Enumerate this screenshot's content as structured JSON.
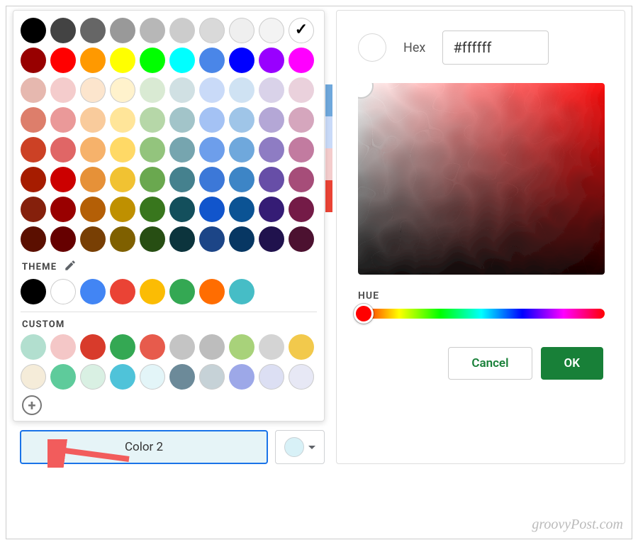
{
  "palette_rows": [
    [
      "#000000",
      "#434343",
      "#666666",
      "#999999",
      "#b7b7b7",
      "#cccccc",
      "#d9d9d9",
      "#efefef",
      "#f3f3f3",
      "#ffffff"
    ],
    [
      "#980000",
      "#ff0000",
      "#ff9900",
      "#ffff00",
      "#00ff00",
      "#00ffff",
      "#4a86e8",
      "#0000ff",
      "#9900ff",
      "#ff00ff"
    ],
    [
      "#e6b8af",
      "#f4cccc",
      "#fce5cd",
      "#fff2cc",
      "#d9ead3",
      "#d0e0e3",
      "#c9daf8",
      "#cfe2f3",
      "#d9d2e9",
      "#ead1dc"
    ],
    [
      "#dd7e6b",
      "#ea9999",
      "#f9cb9c",
      "#ffe599",
      "#b6d7a8",
      "#a2c4c9",
      "#a4c2f4",
      "#9fc5e8",
      "#b4a7d6",
      "#d5a6bd"
    ],
    [
      "#cc4125",
      "#e06666",
      "#f6b26b",
      "#ffd966",
      "#93c47d",
      "#76a5af",
      "#6d9eeb",
      "#6fa8dc",
      "#8e7cc3",
      "#c27ba0"
    ],
    [
      "#a61c00",
      "#cc0000",
      "#e69138",
      "#f1c232",
      "#6aa84f",
      "#45818e",
      "#3c78d8",
      "#3d85c6",
      "#674ea7",
      "#a64d79"
    ],
    [
      "#85200c",
      "#990000",
      "#b45f06",
      "#bf9000",
      "#38761d",
      "#134f5c",
      "#1155cc",
      "#0b5394",
      "#351c75",
      "#741b47"
    ],
    [
      "#5b0f00",
      "#660000",
      "#783f04",
      "#7f6000",
      "#274e13",
      "#0c343d",
      "#1c4587",
      "#073763",
      "#20124d",
      "#4c1130"
    ]
  ],
  "selected_swatch": "#ffffff",
  "theme": {
    "label": "THEME",
    "colors": [
      "#000000",
      "#ffffff",
      "#4285f4",
      "#ea4335",
      "#fbbc04",
      "#34a853",
      "#ff6d01",
      "#46bdc6"
    ]
  },
  "custom": {
    "label": "CUSTOM",
    "colors": [
      "#b2dfcf",
      "#f4c7c7",
      "#d83b2b",
      "#34a853",
      "#e75b4c",
      "#c4c4c4",
      "#bdbdbd",
      "#a8d27a",
      "#d4d4d4",
      "#f2c94c",
      "#f5ecd9",
      "#5ecb9b",
      "#d9f0e3",
      "#4fc3d9",
      "#e3f5f8",
      "#6c8a99",
      "#c6d2d7",
      "#9da8e8",
      "#dcdff3",
      "#e7e8f5"
    ]
  },
  "bottom": {
    "chip_label": "Color 2",
    "dropdown_color": "#d8f1f7"
  },
  "picker": {
    "hex_label": "Hex",
    "hex_value": "#ffffff",
    "hue_label": "HUE",
    "cancel_label": "Cancel",
    "ok_label": "OK"
  },
  "side_strips": [
    "#6fa8dc",
    "#c9daf8",
    "#f4cccc",
    "#ea4335",
    "#ffffff"
  ],
  "light_threshold_hexes": [
    "#ffffff",
    "#f3f3f3",
    "#efefef",
    "#fff2cc",
    "#fce5cd",
    "#d9d9d9",
    "#f5ecd9",
    "#e3f5f8",
    "#d9f0e3",
    "#dcdff3",
    "#e7e8f5",
    "#c6d2d7"
  ],
  "watermark": "groovyPost.com"
}
